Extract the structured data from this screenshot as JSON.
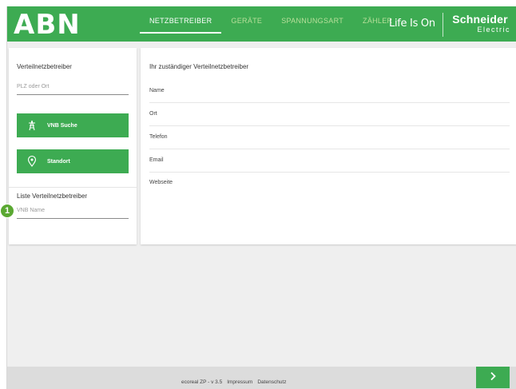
{
  "header": {
    "logo": "ABN",
    "nav": [
      {
        "label": "NETZBETREIBER",
        "active": true
      },
      {
        "label": "GERÄTE",
        "active": false
      },
      {
        "label": "SPANNUNGSART",
        "active": false
      },
      {
        "label": "ZÄHLER",
        "active": false
      }
    ],
    "tagline": "Life Is On",
    "brand_name": "Schneider",
    "brand_sub": "Electric"
  },
  "left_panel": {
    "title": "Verteilnetzbetreiber",
    "postal_placeholder": "PLZ oder Ort",
    "search_button": "VNB Suche",
    "location_button": "Standort",
    "list_title": "Liste Verteilnetzbetreiber",
    "vnb_placeholder": "VNB Name"
  },
  "right_panel": {
    "title": "Ihr zuständiger Verteilnetzbetreiber",
    "rows": [
      "Name",
      "Ort",
      "Telefon",
      "Email",
      "Webseite"
    ]
  },
  "footer": {
    "version": "ecoreal ZP - v 3.5",
    "impressum": "Impressum",
    "datenschutz": "Datenschutz"
  },
  "callout": {
    "number": "1"
  },
  "colors": {
    "brand_green": "#3dab52",
    "background": "#efefef",
    "badge_green": "#5aa832"
  },
  "icons": {
    "search_button": "power-pylon-icon",
    "location_button": "location-pin-icon",
    "next_button": "chevron-right-icon"
  }
}
